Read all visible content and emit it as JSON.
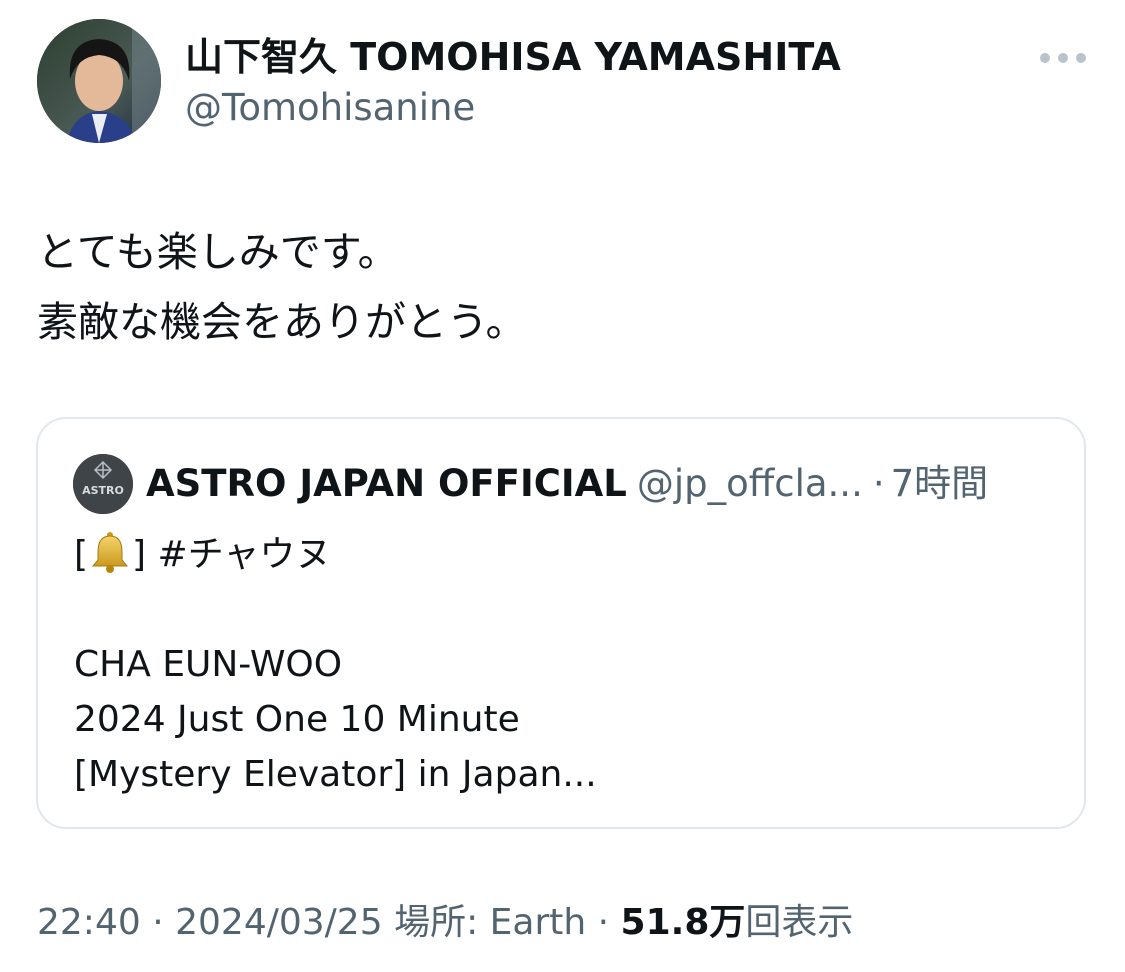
{
  "author": {
    "name": "山下智久 TOMOHISA YAMASHITA",
    "handle": "@Tomohisanine"
  },
  "tweet": {
    "lines": [
      "とても楽しみです。",
      "素敵な機会をありがとう。"
    ]
  },
  "quote": {
    "name": "ASTRO JAPAN OFFICIAL",
    "handle": "@jp_offcla...",
    "separator": "·",
    "time": "7時間",
    "avatar_text": "ASTRO",
    "hashtag_prefix": "[",
    "hashtag_suffix": "] #チャウヌ",
    "lines": [
      "CHA EUN-WOO",
      "2024 Just One 10 Minute",
      "[Mystery Elevator] in Japan..."
    ]
  },
  "meta": {
    "time": "22:40",
    "sep1": "·",
    "date": "2024/03/25",
    "location": "場所: Earth",
    "sep2": "·",
    "views_count": "51.8万",
    "views_label": "回表示"
  },
  "icons": {
    "more": "more-horizontal-icon",
    "bell": "bell-icon"
  },
  "colors": {
    "text": "#0f1419",
    "secondary": "#536471",
    "border": "#e1e8ed"
  }
}
